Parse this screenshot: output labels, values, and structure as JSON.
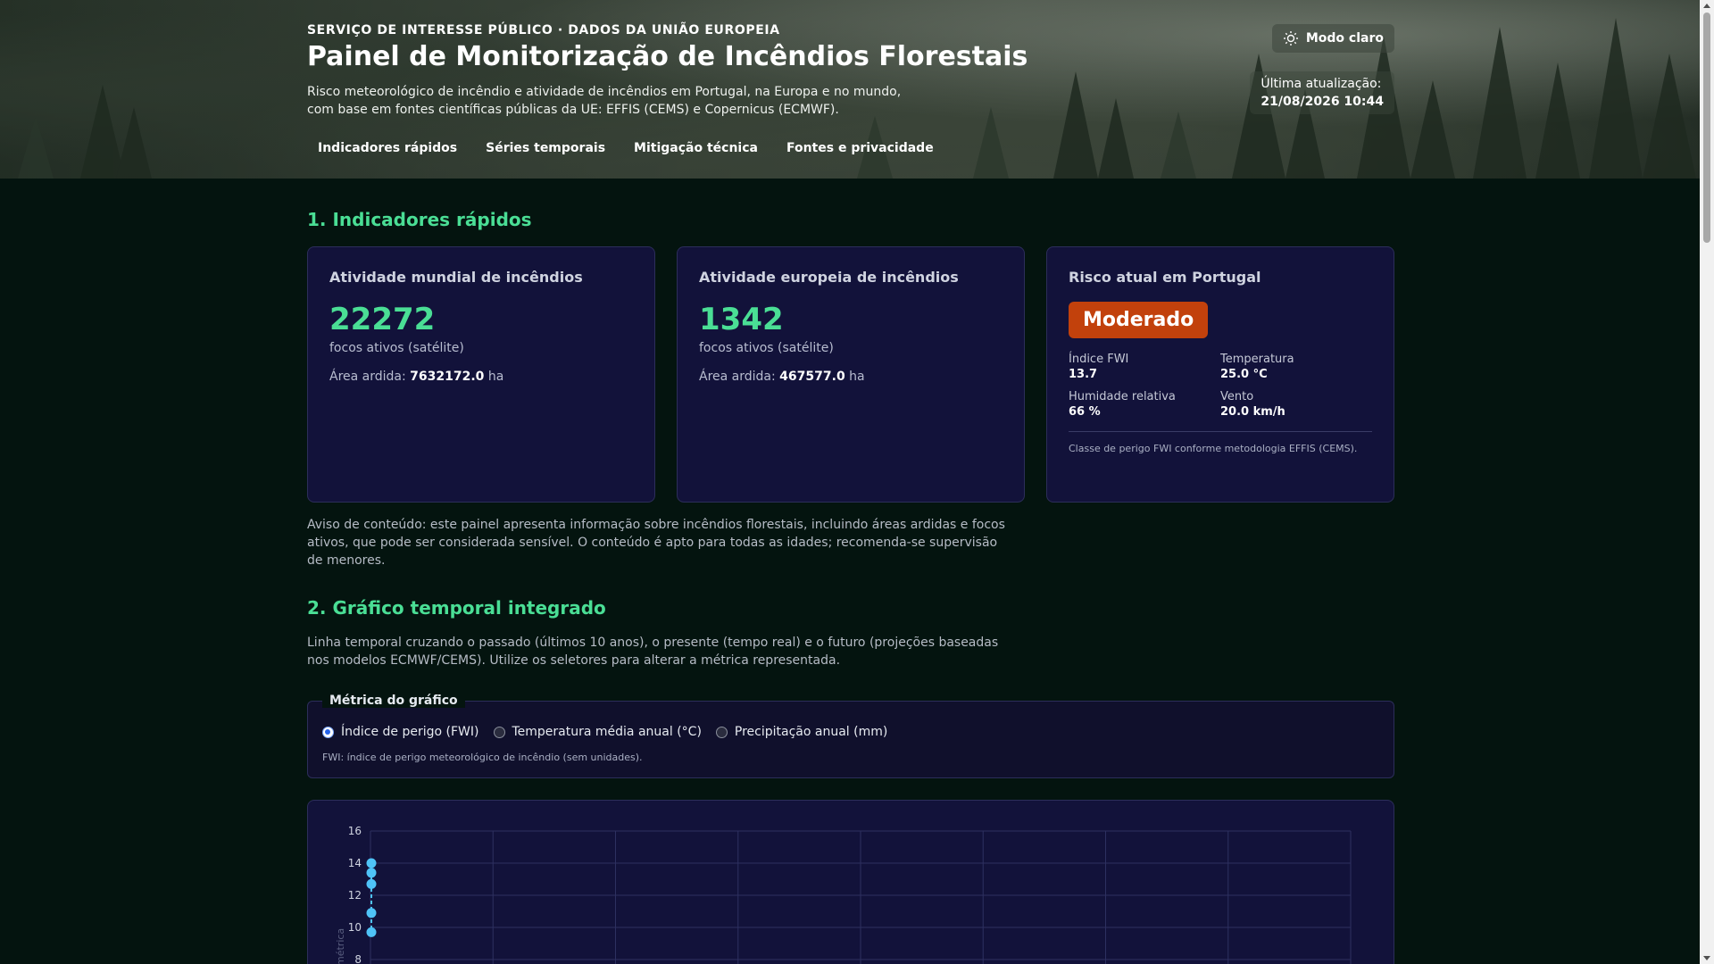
{
  "header": {
    "eyebrow": "SERVIÇO DE INTERESSE PÚBLICO · DADOS DA UNIÃO EUROPEIA",
    "title": "Painel de Monitorização de Incêndios Florestais",
    "subtitle": "Risco meteorológico de incêndio e atividade de incêndios em Portugal, na Europa e no mundo, com base em fontes científicas públicas da UE: EFFIS (CEMS) e Copernicus (ECMWF).",
    "nav": [
      "Indicadores rápidos",
      "Séries temporais",
      "Mitigação técnica",
      "Fontes e privacidade"
    ],
    "theme_button": "Modo claro",
    "theme_icon": "sun-icon",
    "updated_label": "Última atualização:",
    "updated_value": "21/08/2026 10:44"
  },
  "section1": {
    "title": "1. Indicadores rápidos",
    "world": {
      "title": "Atividade mundial de incêndios",
      "value": "22272",
      "sub": "focos ativos (satélite)",
      "area_label": "Área ardida:",
      "area_value": "7632172.0",
      "area_unit": "ha"
    },
    "europe": {
      "title": "Atividade europeia de incêndios",
      "value": "1342",
      "sub": "focos ativos (satélite)",
      "area_label": "Área ardida:",
      "area_value": "467577.0",
      "area_unit": "ha"
    },
    "portugal": {
      "title": "Risco atual em Portugal",
      "risk": "Moderado",
      "risk_color": "#c2410c",
      "fwi_label": "Índice FWI",
      "fwi_value": "13.7",
      "temp_label": "Temperatura",
      "temp_value": "25.0 °C",
      "hum_label": "Humidade relativa",
      "hum_value": "66 %",
      "wind_label": "Vento",
      "wind_value": "20.0 km/h",
      "note": "Classe de perigo FWI conforme metodologia EFFIS (CEMS)."
    },
    "warning": "Aviso de conteúdo: este painel apresenta informação sobre incêndios florestais, incluindo áreas ardidas e focos ativos, que pode ser considerada sensível. O conteúdo é apto para todas as idades; recomenda-se supervisão de menores."
  },
  "section2": {
    "title": "2. Gráfico temporal integrado",
    "intro": "Linha temporal cruzando o passado (últimos 10 anos), o presente (tempo real) e o futuro (projeções baseadas nos modelos ECMWF/CEMS). Utilize os seletores para alterar a métrica representada.",
    "legend": "Métrica do gráfico",
    "options": [
      "Índice de perigo (FWI)",
      "Temperatura média anual (°C)",
      "Precipitação anual (mm)"
    ],
    "selected_option": 0,
    "option_note": "FWI: índice de perigo meteorológico de incêndio (sem unidades)."
  },
  "chart_data": {
    "type": "line",
    "ylabel": "métrica",
    "y_ticks": [
      "16",
      "14",
      "12",
      "10",
      "8"
    ],
    "ylim": [
      8,
      16
    ],
    "series": [
      {
        "values": [
          14.0,
          13.4,
          12.7,
          10.9,
          9.7
        ]
      }
    ],
    "grid": true,
    "accent": "#4fc3f7"
  },
  "colors": {
    "accent": "#4ade95",
    "card_bg": "#12123a",
    "page_bg": "#04140f"
  }
}
